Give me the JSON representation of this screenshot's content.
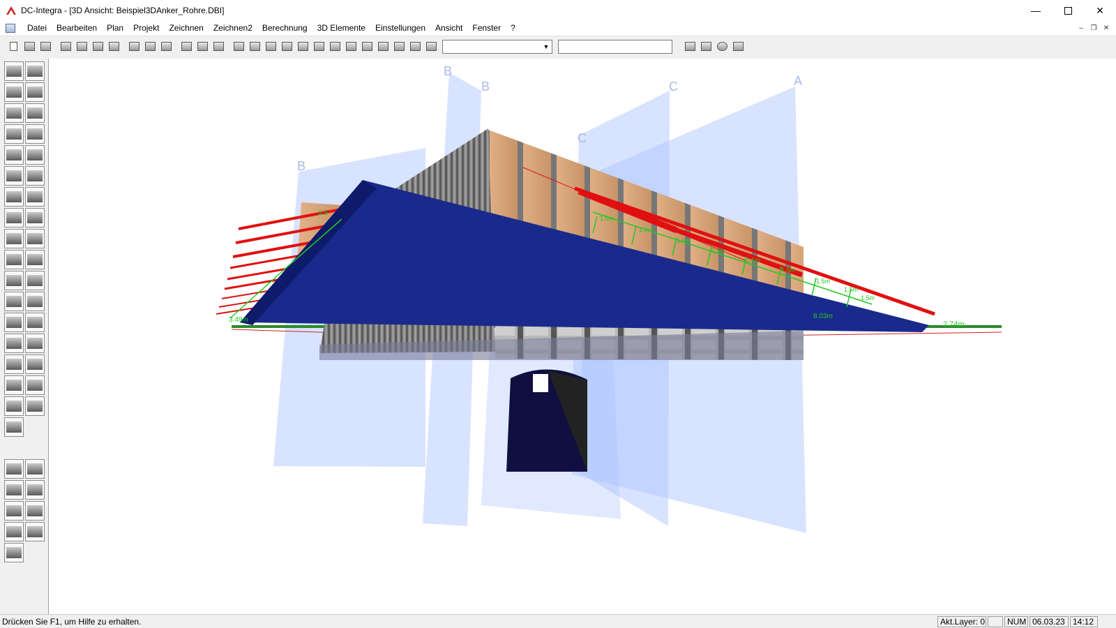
{
  "window": {
    "title": "DC-Integra - [3D Ansicht: Beispiel3DAnker_Rohre.DBI]"
  },
  "menu": [
    "Datei",
    "Bearbeiten",
    "Plan",
    "Projekt",
    "Zeichnen",
    "Zeichnen2",
    "Berechnung",
    "3D Elemente",
    "Einstellungen",
    "Ansicht",
    "Fenster",
    "?"
  ],
  "scene": {
    "axis_labels": [
      "B",
      "B",
      "C",
      "C",
      "A",
      "B"
    ],
    "dimension_labels": [
      "3.49m",
      "0.5",
      "1.5m",
      "1.5m",
      "1.5m",
      "1.5m",
      "1.5m",
      "1.5m",
      "1.5m",
      "1.5m",
      "1.5m",
      "8.03m",
      "2.74m"
    ],
    "colors": {
      "anchor": "#e01010",
      "waler": "#1a2a8c",
      "plane": "#a8c0ff",
      "dimension": "#22c822",
      "ground": "#2a8a2a"
    }
  },
  "status": {
    "hint": "Drücken Sie F1, um Hilfe zu erhalten.",
    "layer": "Akt.Layer: 0",
    "num": "NUM",
    "date": "06.03.23",
    "time": "14:12"
  }
}
